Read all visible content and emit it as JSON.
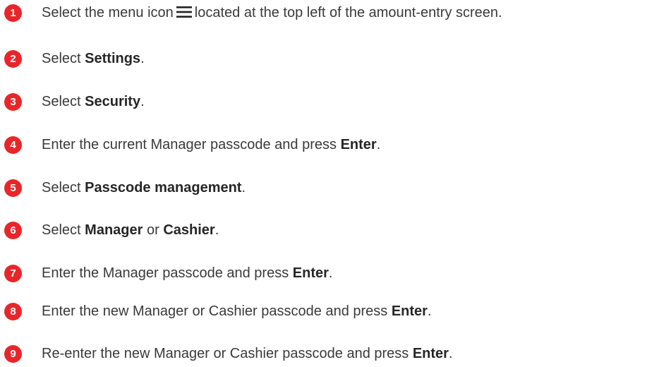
{
  "steps": [
    {
      "number": "1",
      "parts": {
        "a": "Select the menu icon",
        "icon": "hamburger-menu-icon",
        "b": "located at the top left of the amount-entry screen."
      }
    },
    {
      "number": "2",
      "parts": {
        "a": "Select ",
        "b1": "Settings",
        "c": "."
      }
    },
    {
      "number": "3",
      "parts": {
        "a": "Select ",
        "b1": "Security",
        "c": "."
      }
    },
    {
      "number": "4",
      "parts": {
        "a": "Enter the current Manager passcode and press ",
        "b1": "Enter",
        "c": "."
      }
    },
    {
      "number": "5",
      "parts": {
        "a": "Select ",
        "b1": "Passcode management",
        "c": "."
      }
    },
    {
      "number": "6",
      "parts": {
        "a": "Select ",
        "b1": "Manager",
        "m": " or ",
        "b2": "Cashier",
        "c": "."
      }
    },
    {
      "number": "7",
      "parts": {
        "a": "Enter the Manager passcode and press ",
        "b1": "Enter",
        "c": "."
      }
    },
    {
      "number": "8",
      "parts": {
        "a": "Enter the new Manager or Cashier passcode and press ",
        "b1": "Enter",
        "c": "."
      }
    },
    {
      "number": "9",
      "parts": {
        "a": "Re-enter the new Manager or Cashier passcode and press ",
        "b1": "Enter",
        "c": "."
      }
    }
  ],
  "colors": {
    "badge": "#e8262a",
    "text": "#3a3a3a"
  }
}
